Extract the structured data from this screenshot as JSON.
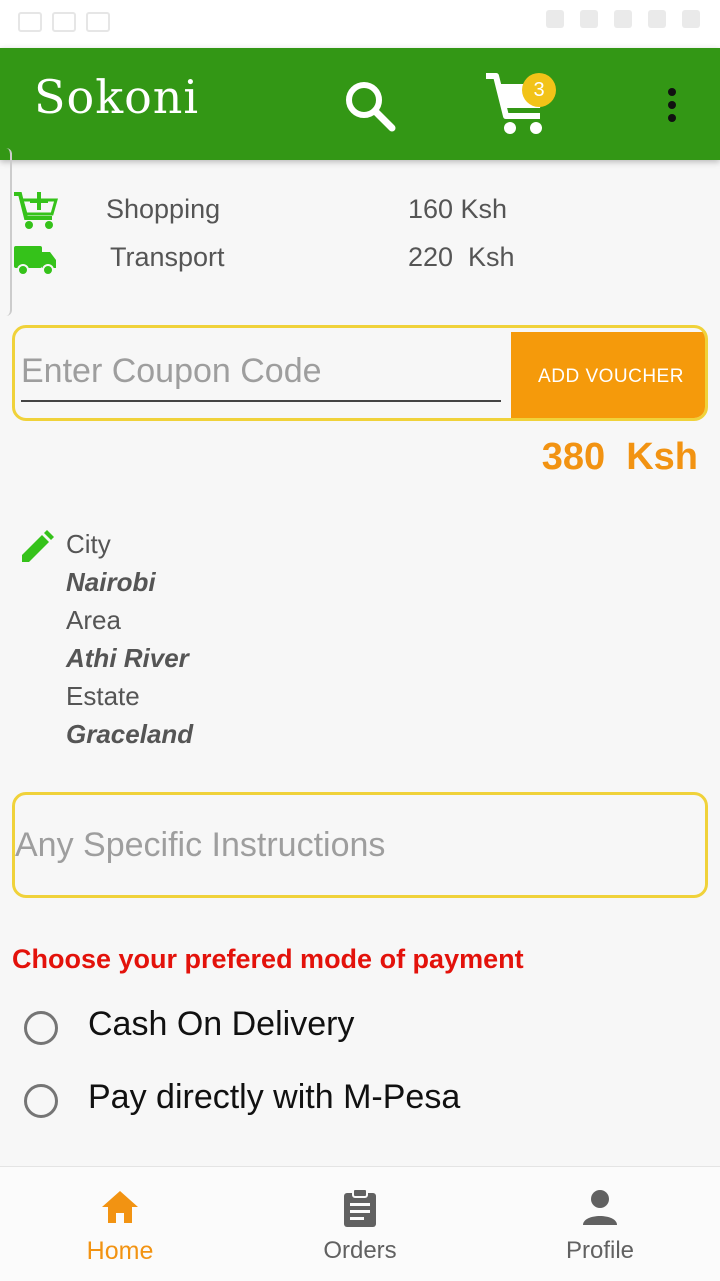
{
  "app": {
    "title": "Sokoni",
    "brand_color": "#339715",
    "accent_color": "#f59a0b"
  },
  "cart": {
    "badge_count": "3"
  },
  "costs": {
    "shopping": {
      "label": "Shopping",
      "value": "160 Ksh"
    },
    "transport": {
      "label": "Transport",
      "value": "220  Ksh"
    }
  },
  "coupon": {
    "placeholder": "Enter Coupon Code",
    "button_label": "ADD VOUCHER"
  },
  "total": "380  Ksh",
  "address": {
    "city_label": "City",
    "city_value": "Nairobi",
    "area_label": "Area",
    "area_value": "Athi River",
    "estate_label": "Estate",
    "estate_value": "Graceland"
  },
  "instructions": {
    "placeholder": "Any Specific Instructions"
  },
  "payment": {
    "heading": "Choose your prefered mode of payment",
    "options": [
      "Cash On Delivery",
      "Pay directly with M-Pesa"
    ]
  },
  "nav": {
    "home": "Home",
    "orders": "Orders",
    "profile": "Profile",
    "active": "home",
    "active_color": "#f29312",
    "inactive_color": "#616161"
  },
  "icons": {
    "search": "search-icon",
    "cart": "cart-icon",
    "menu": "more-vert-icon",
    "add_cart": "add-shopping-cart-icon",
    "truck": "truck-icon",
    "edit": "pencil-icon",
    "home": "home-icon",
    "orders": "clipboard-icon",
    "profile": "person-icon"
  }
}
